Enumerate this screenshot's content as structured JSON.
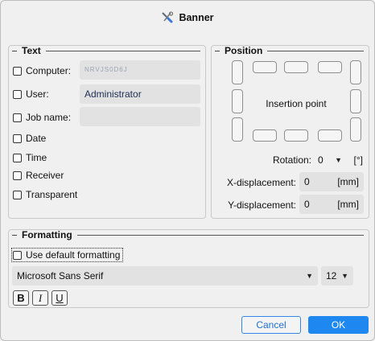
{
  "window": {
    "title": "Banner",
    "icon": "banner-tools-icon"
  },
  "text_group": {
    "title": "Text",
    "computer": {
      "label": "Computer:",
      "value": "NRVJS0D6J",
      "checked": false
    },
    "user": {
      "label": "User:",
      "value": "Administrator",
      "checked": false
    },
    "job_name": {
      "label": "Job name:",
      "value": "",
      "checked": false
    },
    "date": {
      "label": "Date",
      "checked": false
    },
    "time": {
      "label": "Time",
      "checked": false
    },
    "receiver": {
      "label": "Receiver",
      "checked": false
    },
    "transparent": {
      "label": "Transparent",
      "checked": false
    }
  },
  "position_group": {
    "title": "Position",
    "center_label": "Insertion point",
    "rotation": {
      "label": "Rotation:",
      "value": "0",
      "unit": "[°]"
    },
    "x_displacement": {
      "label": "X-displacement:",
      "value": "0",
      "unit": "[mm]"
    },
    "y_displacement": {
      "label": "Y-displacement:",
      "value": "0",
      "unit": "[mm]"
    }
  },
  "formatting_group": {
    "title": "Formatting",
    "use_default": {
      "label": "Use default formatting",
      "checked": false
    },
    "font": "Microsoft Sans Serif",
    "font_size": "12",
    "bold": "B",
    "italic": "I",
    "underline": "U"
  },
  "buttons": {
    "cancel": "Cancel",
    "ok": "OK"
  },
  "colors": {
    "accent": "#1e88f0",
    "field_bg": "#e2e2e2"
  }
}
